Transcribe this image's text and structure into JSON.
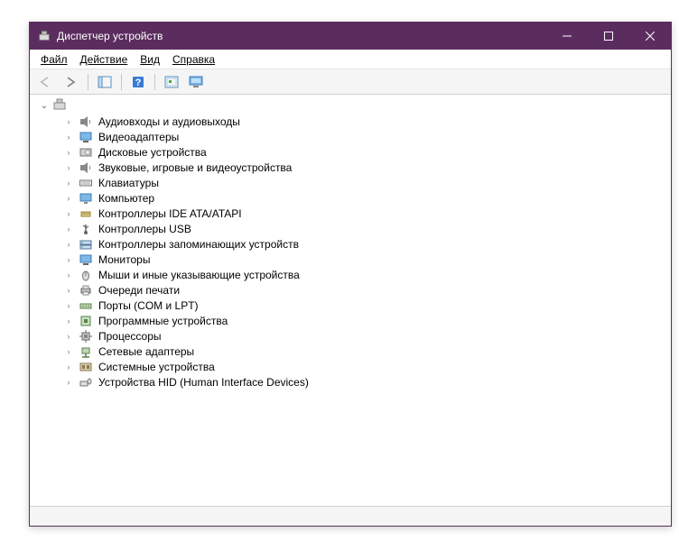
{
  "window": {
    "title": "Диспетчер устройств"
  },
  "menu": {
    "file": "Файл",
    "action": "Действие",
    "view": "Вид",
    "help": "Справка"
  },
  "toolbar": {
    "back": "back",
    "forward": "forward",
    "showhide": "showhide",
    "help": "help",
    "scan": "scan",
    "legacy": "legacy"
  },
  "tree": {
    "root": "",
    "items": [
      {
        "icon": "audio",
        "label": "Аудиовходы и аудиовыходы"
      },
      {
        "icon": "display",
        "label": "Видеоадаптеры"
      },
      {
        "icon": "disk",
        "label": "Дисковые устройства"
      },
      {
        "icon": "audio",
        "label": "Звуковые, игровые и видеоустройства"
      },
      {
        "icon": "keyboard",
        "label": "Клавиатуры"
      },
      {
        "icon": "computer",
        "label": "Компьютер"
      },
      {
        "icon": "ide",
        "label": "Контроллеры IDE ATA/ATAPI"
      },
      {
        "icon": "usb",
        "label": "Контроллеры USB"
      },
      {
        "icon": "storage",
        "label": "Контроллеры запоминающих устройств"
      },
      {
        "icon": "monitor",
        "label": "Мониторы"
      },
      {
        "icon": "mouse",
        "label": "Мыши и иные указывающие устройства"
      },
      {
        "icon": "printer",
        "label": "Очереди печати"
      },
      {
        "icon": "port",
        "label": "Порты (COM и LPT)"
      },
      {
        "icon": "software",
        "label": "Программные устройства"
      },
      {
        "icon": "cpu",
        "label": "Процессоры"
      },
      {
        "icon": "network",
        "label": "Сетевые адаптеры"
      },
      {
        "icon": "system",
        "label": "Системные устройства"
      },
      {
        "icon": "hid",
        "label": "Устройства HID (Human Interface Devices)"
      }
    ]
  }
}
